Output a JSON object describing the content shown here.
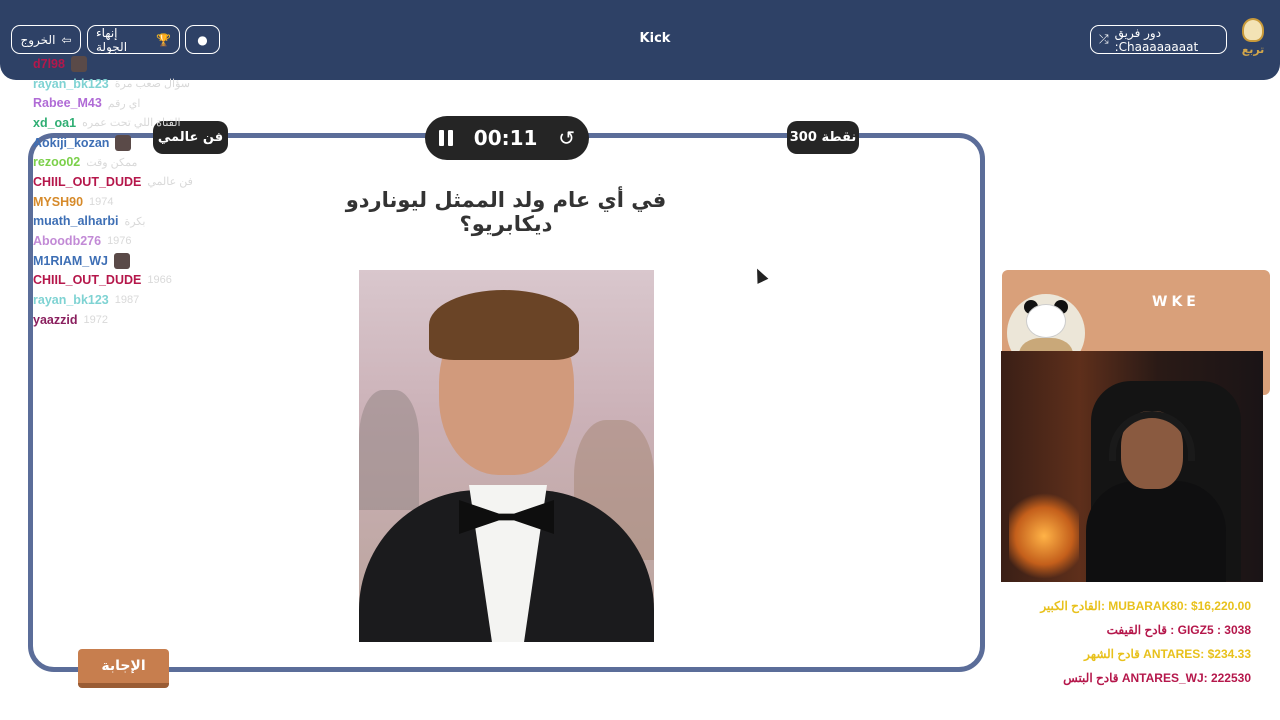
{
  "app": {
    "title": "Kick",
    "logo_text": "تربع"
  },
  "header": {
    "team_role_label": "دور فريق :Chaaaaaaaat",
    "end_round_label": "إنهاء الجولة",
    "exit_label": "الخروج"
  },
  "chat": [
    {
      "user": "d7l98",
      "msg": "",
      "color": "#b5174b",
      "avatar": true
    },
    {
      "user": "rayan_bk123",
      "msg": "سؤال صعب مرة",
      "color": "#7fd3d3",
      "avatar": false
    },
    {
      "user": "Rabee_M43",
      "msg": "اي رقم",
      "color": "#b06bd6",
      "avatar": false
    },
    {
      "user": "xd_oa1",
      "msg": "القناة اللي تحت عمره",
      "color": "#2fae73",
      "avatar": false
    },
    {
      "user": "Aokiji_kozan",
      "msg": "",
      "color": "#3e6fb5",
      "avatar": true
    },
    {
      "user": "rezoo02",
      "msg": "ممكن وقت",
      "color": "#7bd04a",
      "avatar": false
    },
    {
      "user": "CHIIL_OUT_DUDE",
      "msg": "فن عالمي",
      "color": "#b5174b",
      "avatar": false
    },
    {
      "user": "MYSH90",
      "msg": "1974",
      "color": "#d68a2a",
      "avatar": false
    },
    {
      "user": "muath_alharbi",
      "msg": "بكرة",
      "color": "#3e6fb5",
      "avatar": false
    },
    {
      "user": "Aboodb276",
      "msg": "1976",
      "color": "#c28ad6",
      "avatar": false
    },
    {
      "user": "M1RIAM_WJ",
      "msg": "",
      "color": "#3e6fb5",
      "avatar": true
    },
    {
      "user": "CHIIL_OUT_DUDE",
      "msg": "1966",
      "color": "#b5174b",
      "avatar": false
    },
    {
      "user": "rayan_bk123",
      "msg": "1987",
      "color": "#7fd3d3",
      "avatar": false
    },
    {
      "user": "yaazzid",
      "msg": "1972",
      "color": "#8a1f5e",
      "avatar": false
    }
  ],
  "question": {
    "category": "فن عالمي",
    "points": "300 نقطة",
    "timer": "00:11",
    "text": "في أي عام ولد الممثل ليوناردو ديكابريو؟",
    "answer_label": "الإجابة"
  },
  "streamer": {
    "name": "WKE"
  },
  "leaders": [
    {
      "text": "القادح الكبير: MUBARAK80: $16,220.00",
      "color": "#e8c11c"
    },
    {
      "text": "قادح القيفت : GIGZ5 : 3038",
      "color": "#b5174b"
    },
    {
      "text": "قادح الشهر ANTARES: $234.33",
      "color": "#e8c11c"
    },
    {
      "text": "قادح البتس ANTARES_WJ: 222530",
      "color": "#b5174b"
    }
  ],
  "colors": {
    "header_bg": "#2e4166",
    "card_border": "#5b6d99",
    "answer_button": "#c77e4e",
    "streamer_panel": "#d9a07a"
  }
}
